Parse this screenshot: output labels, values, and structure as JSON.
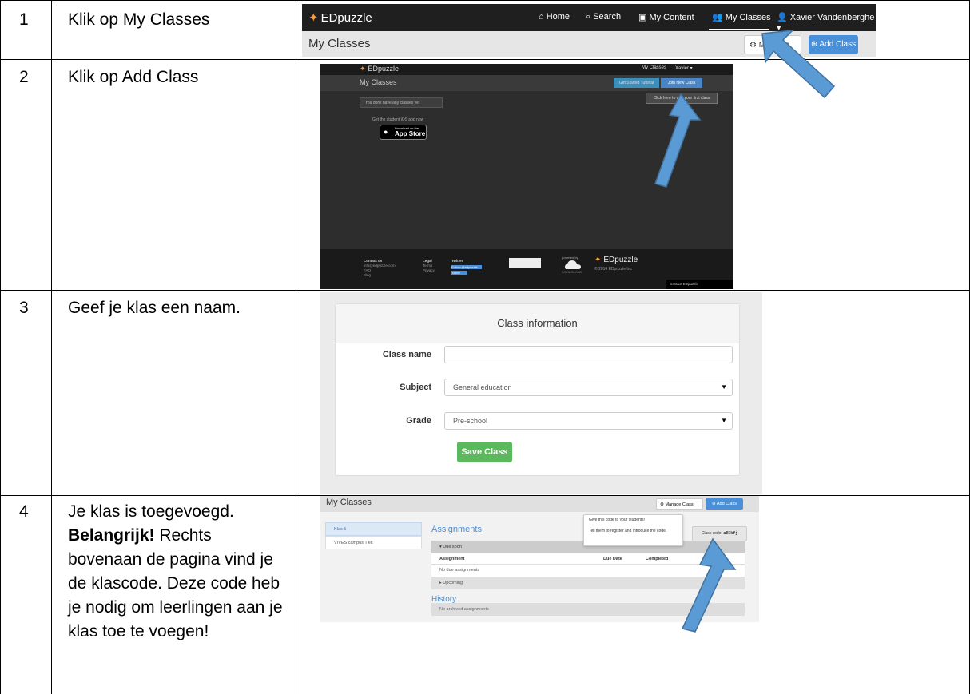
{
  "steps": [
    {
      "number": "1",
      "instruction": "Klik op My Classes"
    },
    {
      "number": "2",
      "instruction": "Klik op Add Class"
    },
    {
      "number": "3",
      "instruction": "Geef je klas een naam."
    },
    {
      "number": "4",
      "instruction_bold": "Belangrijk!",
      "instruction_before": "Je klas is toegevoegd.",
      "instruction_after": "Rechts bovenaan de pagina vind je de klascode. Deze code heb je nodig om leerlingen aan je klas toe te voegen!"
    }
  ],
  "shot1": {
    "logo": "EDpuzzle",
    "nav": [
      "Home",
      "Search",
      "My Content",
      "My Classes",
      "Xavier Vandenberghe ▾"
    ],
    "title": "My Classes",
    "manage_partial": "M",
    "manage_tail": "ss",
    "add_class": "Add Class"
  },
  "shot2": {
    "logo": "EDpuzzle",
    "nav_classes": "My Classes",
    "nav_user": "Xavier ▾",
    "title": "My Classes",
    "btn_tutorial": "Get Started Tutorial",
    "btn_join": "Join New Class",
    "tip": "Click here to add your first class",
    "empty": "You don't have any classes yet",
    "ios_text": "Get the student iOS app now",
    "store_small": "Download on the",
    "store_big": "App Store",
    "footer_contact_title": "Contact us",
    "footer_contact": [
      "info@edpuzzle.com",
      "FAQ",
      "Blog"
    ],
    "footer_legal_title": "Legal",
    "footer_legal": [
      "Terms",
      "Privacy"
    ],
    "footer_twitter_title": "Twitter",
    "footer_twitter": [
      "Follow @edpuzzle",
      "Tweet"
    ],
    "cloud_label": "powered by",
    "cloud_name": "SOUNDCLOUD",
    "footer_logo": "EDpuzzle",
    "footer_copy": "© 2014 EDpuzzle Inc",
    "contact_bar": "Contact EDpuzzle"
  },
  "shot3": {
    "header": "Class information",
    "label_name": "Class name",
    "label_subject": "Subject",
    "subject_value": "General education",
    "label_grade": "Grade",
    "grade_value": "Pre-school",
    "save": "Save Class"
  },
  "shot4": {
    "title": "My Classes",
    "manage": "Manage Class",
    "add": "Add Class",
    "sidebar": [
      "Klas 5",
      "VIVES campus Tielt"
    ],
    "assignments": "Assignments",
    "tip_line1": "Give this code to your students!",
    "tip_line2": "Tell them to register and introduce the code.",
    "code_label": "Class code:",
    "code_value": "a85kfj",
    "due_soon": "▾ Due soon",
    "col_assignment": "Assignment",
    "col_due": "Due Date",
    "col_completed": "Completed",
    "no_due": "No due assignments",
    "upcoming": "▸ Upcoming",
    "history": "History",
    "no_archived": "No archived assignments"
  },
  "colors": {
    "edpuzzle_blue": "#4a90d9",
    "save_green": "#5cb85c",
    "arrow_fill": "#5b9bd5",
    "arrow_stroke": "#41719c"
  }
}
